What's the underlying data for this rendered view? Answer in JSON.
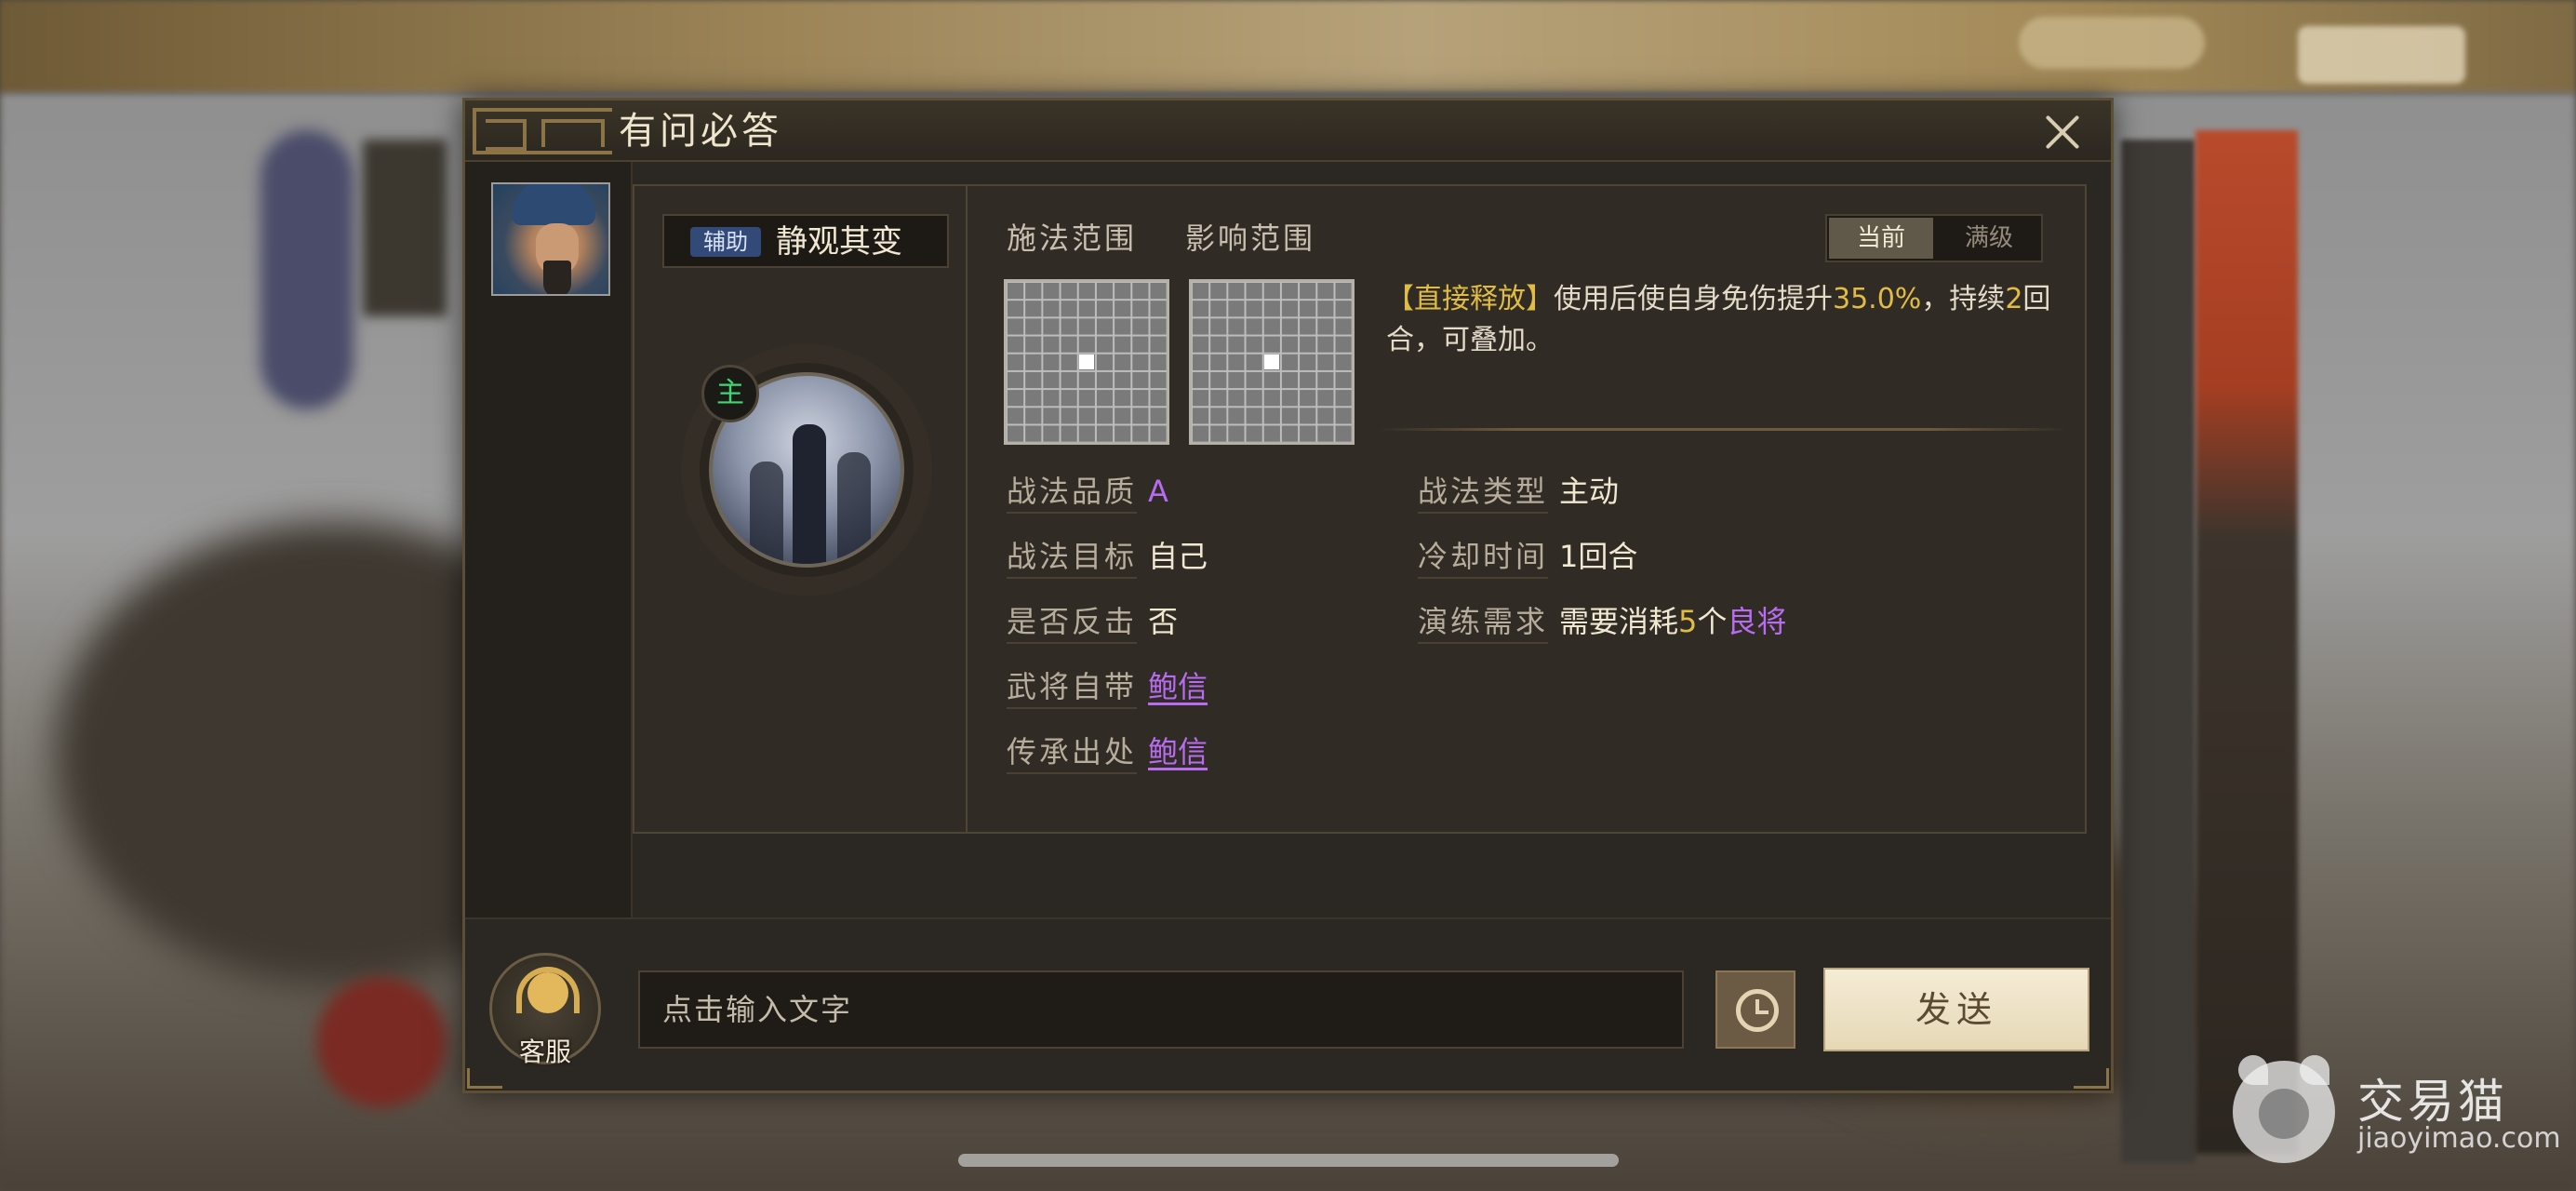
{
  "dialog": {
    "title": "有问必答",
    "close_icon": "close-icon"
  },
  "skill": {
    "tag": "辅助",
    "name": "静观其变",
    "main_badge": "主",
    "cast_range_label": "施法范围",
    "effect_range_label": "影响范围",
    "level_toggle": {
      "current": "当前",
      "max": "满级"
    },
    "description": {
      "keyword": "【直接释放】",
      "part1": "使用后使自身免伤提升",
      "percent": "35.0%",
      "part2": "，持续",
      "rounds": "2",
      "part3": "回合，可叠加。"
    },
    "stats": {
      "quality_label": "战法品质",
      "quality_value": "A",
      "target_label": "战法目标",
      "target_value": "自己",
      "counter_label": "是否反击",
      "counter_value": "否",
      "innate_label": "武将自带",
      "innate_value": "鲍信",
      "inherit_label": "传承出处",
      "inherit_value": "鲍信",
      "type_label": "战法类型",
      "type_value": "主动",
      "cooldown_label": "冷却时间",
      "cooldown_value": "1回合",
      "train_label": "演练需求",
      "train_prefix": "需要消耗",
      "train_count": "5",
      "train_unit": "个",
      "train_item": "良将"
    }
  },
  "chat": {
    "customer_service_label": "客服",
    "input_placeholder": "点击输入文字",
    "send_label": "发送"
  },
  "watermark": {
    "name": "交易猫",
    "url": "jiaoyimao.com"
  },
  "colors": {
    "highlight_gold": "#e1bc45",
    "link_purple": "#b96cf2",
    "main_badge_green": "#3fd673",
    "tag_blue": "#334a78"
  }
}
